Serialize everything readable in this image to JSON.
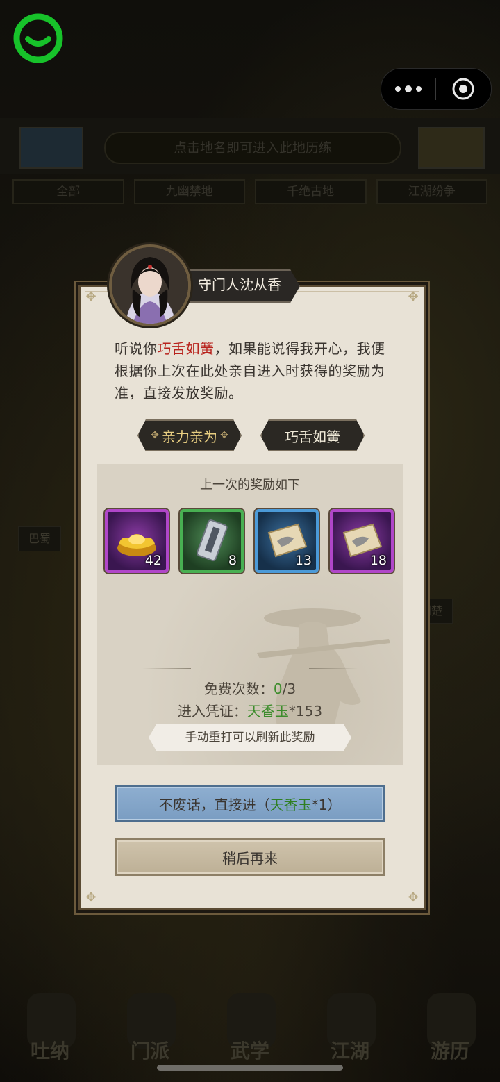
{
  "background": {
    "hint": "点击地名即可进入此地历练",
    "tabs": [
      "全部",
      "九幽禁地",
      "千绝古地",
      "江湖纷争"
    ],
    "map_labels": [
      "巴蜀",
      "荆楚"
    ],
    "bottom_nav": [
      "吐纳",
      "门派",
      "武学",
      "江湖",
      "游历"
    ]
  },
  "dialog": {
    "npc_name": "守门人沈从香",
    "dialogue_pre": "听说你",
    "dialogue_highlight": "巧舌如簧",
    "dialogue_post": "，如果能说得我开心，我便根据你上次在此处亲自进入时获得的奖励为准，直接发放奖励。",
    "choice_left": "亲力亲为",
    "choice_right": "巧舌如簧",
    "reward_title": "上一次的奖励如下",
    "rewards": [
      {
        "icon": "gold-ingot-icon",
        "count": "42",
        "rarity": "purple"
      },
      {
        "icon": "token-card-icon",
        "count": "8",
        "rarity": "green"
      },
      {
        "icon": "scroll-icon",
        "count": "13",
        "rarity": "blue"
      },
      {
        "icon": "scroll-icon",
        "count": "18",
        "rarity": "purple"
      }
    ],
    "free_label": "免费次数：",
    "free_used": "0",
    "free_total": "/3",
    "ticket_label": "进入凭证：",
    "ticket_name": "天香玉",
    "ticket_count": "*153",
    "refresh_tip": "手动重打可以刷新此奖励",
    "enter_pre": "不废话，直接进（",
    "enter_item": "天香玉",
    "enter_post": "*1）",
    "later": "稍后再来"
  },
  "colors": {
    "highlight_red": "#b8231d",
    "highlight_green": "#3d8c2c",
    "gold_text": "#e9cf82"
  }
}
